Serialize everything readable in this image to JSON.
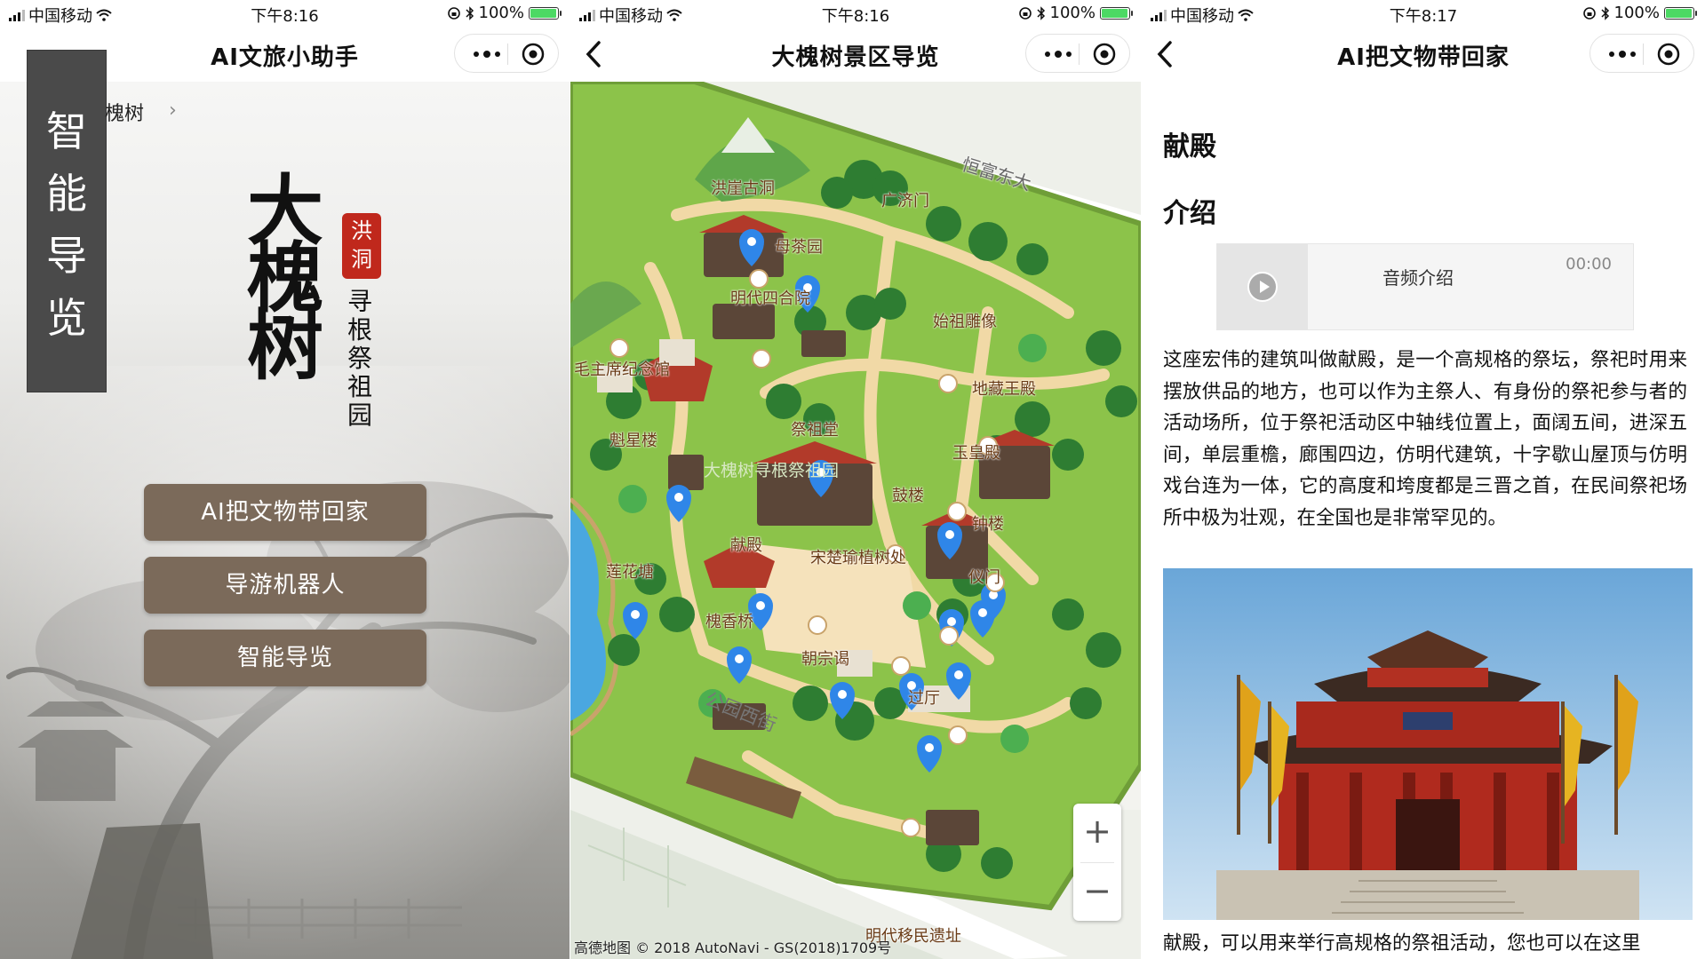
{
  "colors": {
    "button_brown": "#7b6a5a",
    "seal_red": "#c0281c",
    "battery_green": "#4cd964",
    "pin_blue": "#2f86e8"
  },
  "status_bars": [
    {
      "carrier": "中国移动",
      "time": "下午8:16",
      "battery": "100%"
    },
    {
      "carrier": "中国移动",
      "time": "下午8:16",
      "battery": "100%"
    },
    {
      "time": "下午8:17",
      "battery": "100%"
    }
  ],
  "panel1": {
    "title": "AI文旅小助手",
    "side_tag": [
      "智",
      "能",
      "导",
      "览"
    ],
    "breadcrumb": "槐树",
    "logo_big": [
      "大",
      "槐",
      "树"
    ],
    "logo_seal": [
      "洪",
      "洞"
    ],
    "logo_sub": [
      "寻",
      "根",
      "祭",
      "祖",
      "园"
    ],
    "buttons": [
      "AI把文物带回家",
      "导游机器人",
      "智能导览"
    ]
  },
  "panel2": {
    "title": "大槐树景区导览",
    "labels": [
      "洪崖古洞",
      "广济门",
      "恒富东大",
      "明代四合院",
      "始祖雕像",
      "毛主席纪念馆",
      "地藏王殿",
      "祭祖堂",
      "魁星楼",
      "大槐树寻根祭祖园",
      "玉皇殿",
      "鼓楼",
      "钟楼",
      "献殿",
      "宋楚瑜植树处",
      "莲花塘",
      "仪门",
      "槐香桥",
      "朝宗谒",
      "过厅",
      "公园西街",
      "明代移民遗址",
      "母茶园"
    ],
    "zoom_in": "+",
    "zoom_out": "−",
    "attribution": "高德地图 © 2018 AutoNavi - GS(2018)1709号"
  },
  "panel3": {
    "title": "AI把文物带回家",
    "heading": "献殿",
    "intro_heading": "介绍",
    "audio_label": "音频介绍",
    "audio_time": "00:00",
    "paragraph": "这座宏伟的建筑叫做献殿，是一个高规格的祭坛，祭祀时用来摆放供品的地方，也可以作为主祭人、有身份的祭祀参与者的活动场所，位于祭祀活动区中轴线位置上，面阔五间，进深五间，单层重檐，廊围四边，仿明代建筑，十字歇山屋顶与仿明戏台连为一体，它的高度和垮度都是三晋之首，在民间祭祀场所中极为壮观，在全国也是非常罕见的。",
    "paragraph2": "献殿，可以用来举行高规格的祭祖活动，您也可以在这里"
  }
}
